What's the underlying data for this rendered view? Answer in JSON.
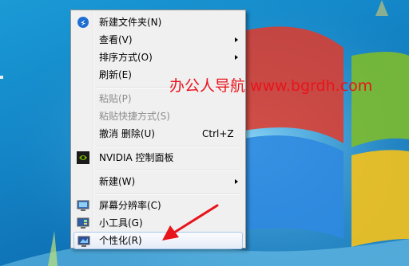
{
  "menu": {
    "items": [
      {
        "label": "新建文件夹(N)",
        "icon": "new-folder-icon",
        "enabled": true
      },
      {
        "label": "查看(V)",
        "submenu": true,
        "enabled": true
      },
      {
        "label": "排序方式(O)",
        "submenu": true,
        "enabled": true
      },
      {
        "label": "刷新(E)",
        "enabled": true
      },
      {
        "label": "粘贴(P)",
        "enabled": false
      },
      {
        "label": "粘贴快捷方式(S)",
        "enabled": false
      },
      {
        "label": "撤消 删除(U)",
        "shortcut": "Ctrl+Z",
        "enabled": true
      },
      {
        "label": "NVIDIA 控制面板",
        "icon": "nvidia-icon",
        "enabled": true
      },
      {
        "label": "新建(W)",
        "submenu": true,
        "enabled": true
      },
      {
        "label": "屏幕分辨率(C)",
        "icon": "screen-resolution-icon",
        "enabled": true
      },
      {
        "label": "小工具(G)",
        "icon": "gadgets-icon",
        "enabled": true
      },
      {
        "label": "个性化(R)",
        "icon": "personalize-icon",
        "enabled": true,
        "highlighted": true
      }
    ]
  },
  "watermark": {
    "text": "办公人导航 www.bgrdh.com",
    "color": "#e8141c"
  },
  "annotation": {
    "arrow_color": "#e8141c",
    "points_to": "个性化(R)"
  },
  "colors": {
    "desktop": "#1487c8",
    "menu_bg": "#f0f0f0",
    "hover_border": "#a8c8eb"
  }
}
